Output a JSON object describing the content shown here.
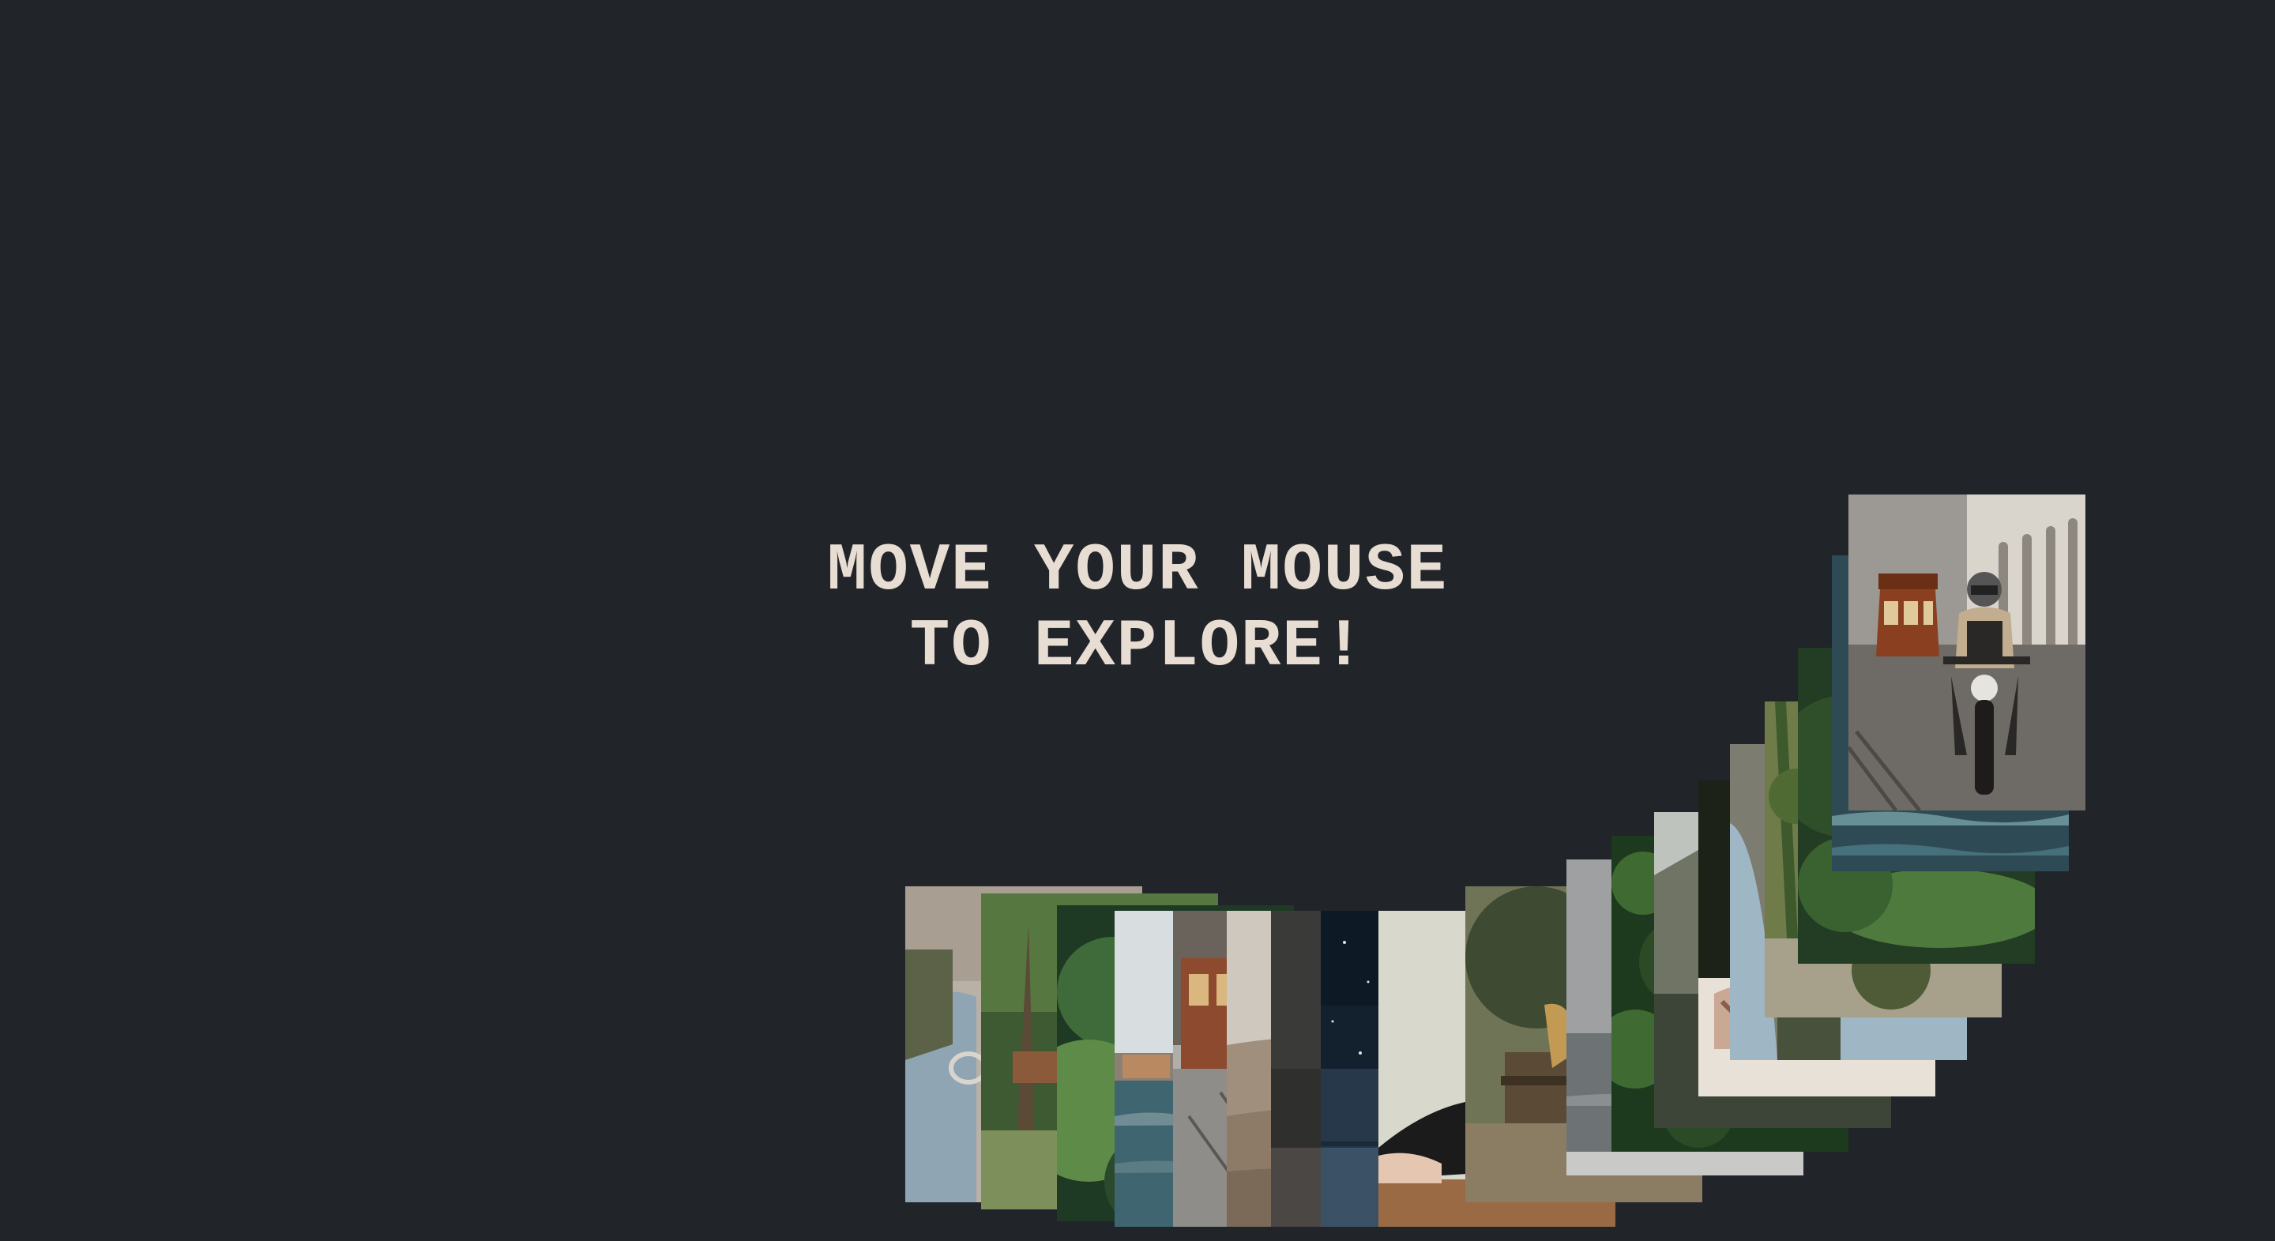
{
  "headline": {
    "line1": "MOVE YOUR MOUSE",
    "line2": "TO EXPLORE!"
  },
  "colors": {
    "background": "#212429",
    "headline": "#e8ddd3"
  },
  "photo_trail": {
    "count": 24,
    "photos": [
      {
        "name": "photo-knit-sweater",
        "palette": [
          "#b9b1a6",
          "#8fa5b4",
          "#5c6248"
        ]
      },
      {
        "name": "photo-forest-trees",
        "palette": [
          "#3d5a32",
          "#7d8f5a",
          "#a49a7e"
        ]
      },
      {
        "name": "photo-green-foliage",
        "palette": [
          "#1f3a24",
          "#3f6a3a",
          "#5e8b48"
        ]
      },
      {
        "name": "photo-beach-sea",
        "palette": [
          "#d8dde0",
          "#3f6670",
          "#6f8d93"
        ]
      },
      {
        "name": "photo-tram-street",
        "palette": [
          "#6a635c",
          "#8d4a2e",
          "#b0aea9"
        ]
      },
      {
        "name": "photo-sand-dune",
        "palette": [
          "#cfc8bf",
          "#a08f7c",
          "#7b6a58"
        ]
      },
      {
        "name": "photo-dark-texture",
        "palette": [
          "#2f2f2e",
          "#3a3a38",
          "#4a4744"
        ]
      },
      {
        "name": "photo-night-sky",
        "palette": [
          "#13212f",
          "#26384a",
          "#3b5266"
        ]
      },
      {
        "name": "photo-person-on-floor",
        "palette": [
          "#d8d9cc",
          "#1b1b1b",
          "#9a6a45"
        ]
      },
      {
        "name": "photo-bench-park",
        "palette": [
          "#3f4a33",
          "#6f7457",
          "#c29a53"
        ]
      },
      {
        "name": "photo-grey-sea",
        "palette": [
          "#9ea0a2",
          "#6d7275",
          "#5a5f60"
        ]
      },
      {
        "name": "photo-ivy-wall",
        "palette": [
          "#1e3a1e",
          "#3f6b33",
          "#2b4a26"
        ]
      },
      {
        "name": "photo-misty-forest",
        "palette": [
          "#bfc3bd",
          "#6f7465",
          "#3d4538"
        ]
      },
      {
        "name": "photo-hands-knit",
        "palette": [
          "#1d2218",
          "#c9a894",
          "#e8e1d8"
        ]
      },
      {
        "name": "photo-blue-fabric",
        "palette": [
          "#7d7c70",
          "#9fb6c4",
          "#47513c"
        ]
      },
      {
        "name": "photo-rocky-vines",
        "palette": [
          "#6f7c4a",
          "#a7a18b",
          "#4f5a37"
        ]
      },
      {
        "name": "photo-blurred-leaves",
        "palette": [
          "#223d23",
          "#4e7a3e",
          "#2f4e2a"
        ]
      },
      {
        "name": "photo-waves",
        "palette": [
          "#2e4a55",
          "#46707b",
          "#678f96"
        ]
      },
      {
        "name": "photo-motorcycle-tram",
        "palette": [
          "#9c9893",
          "#6e6a65",
          "#2a2826"
        ]
      }
    ]
  }
}
